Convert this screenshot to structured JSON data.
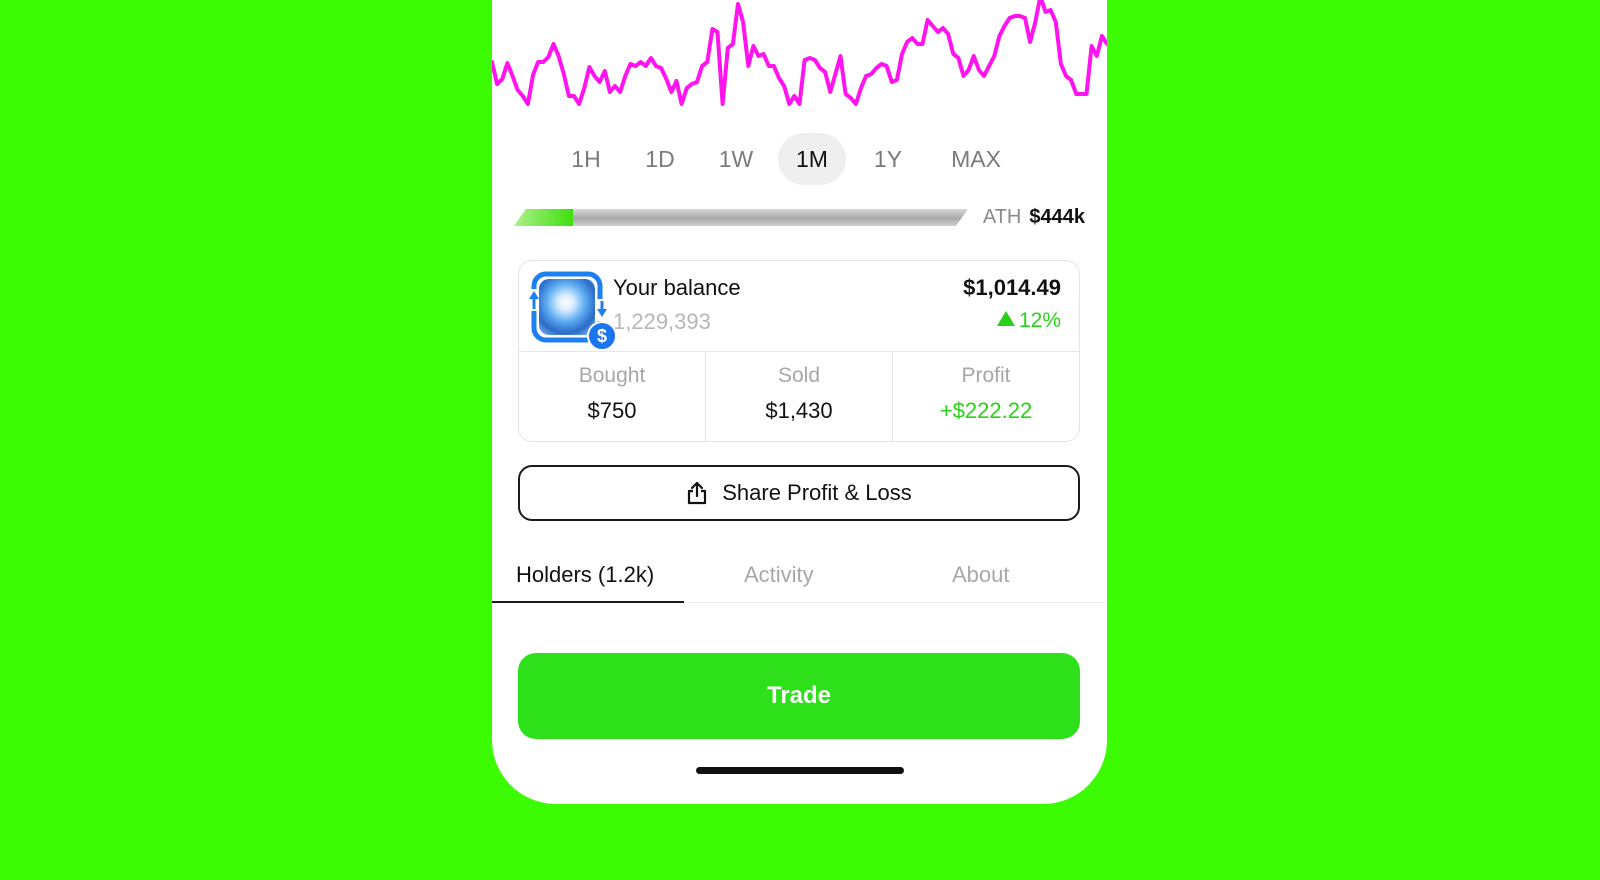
{
  "colors": {
    "page_background": "#3cfc04",
    "chart_line": "#ff14ef",
    "positive": "#2bd118",
    "trade_button": "#2de01a",
    "badge_blue": "#1976f0"
  },
  "chart": {
    "line_color": "#ff14ef",
    "series": [
      42,
      20,
      25,
      41,
      28,
      14,
      8,
      0,
      29,
      42,
      42,
      47,
      60,
      48,
      30,
      8,
      8,
      0,
      16,
      37,
      28,
      22,
      33,
      12,
      18,
      12,
      28,
      40,
      38,
      42,
      38,
      46,
      38,
      36,
      25,
      12,
      23,
      0,
      16,
      20,
      22,
      38,
      42,
      75,
      72,
      0,
      56,
      60,
      100,
      82,
      38,
      58,
      48,
      50,
      38,
      38,
      26,
      18,
      0,
      8,
      0,
      44,
      46,
      44,
      36,
      32,
      12,
      30,
      48,
      10,
      6,
      0,
      16,
      28,
      30,
      36,
      40,
      38,
      22,
      24,
      50,
      62,
      66,
      60,
      60,
      84,
      78,
      72,
      76,
      70,
      50,
      46,
      28,
      34,
      48,
      34,
      28,
      38,
      48,
      68,
      78,
      86,
      88,
      88,
      86,
      62,
      82,
      108,
      92,
      94,
      82,
      40,
      28,
      24,
      10,
      10,
      10,
      58,
      48,
      68,
      60
    ]
  },
  "timeframes": {
    "items": [
      "1H",
      "1D",
      "1W",
      "1M",
      "1Y",
      "MAX"
    ],
    "active": "1M"
  },
  "ath": {
    "label": "ATH",
    "value": "$444k",
    "progress": 0.13
  },
  "balance": {
    "title": "Your balance",
    "token_amount": "1,229,393",
    "value": "$1,014.49",
    "change": "12%",
    "change_direction": "up",
    "token_icon": "token-avatar-icon",
    "badge_icon": "dollar-icon",
    "badge_text": "$"
  },
  "stats": [
    {
      "label": "Bought",
      "value": "$750"
    },
    {
      "label": "Sold",
      "value": "$1,430"
    },
    {
      "label": "Profit",
      "value": "+$222.22"
    }
  ],
  "share": {
    "label": "Share Profit & Loss",
    "icon": "share-icon"
  },
  "tabs": {
    "items": [
      "Holders (1.2k)",
      "Activity",
      "About"
    ],
    "active": "Holders (1.2k)"
  },
  "trade": {
    "label": "Trade"
  }
}
